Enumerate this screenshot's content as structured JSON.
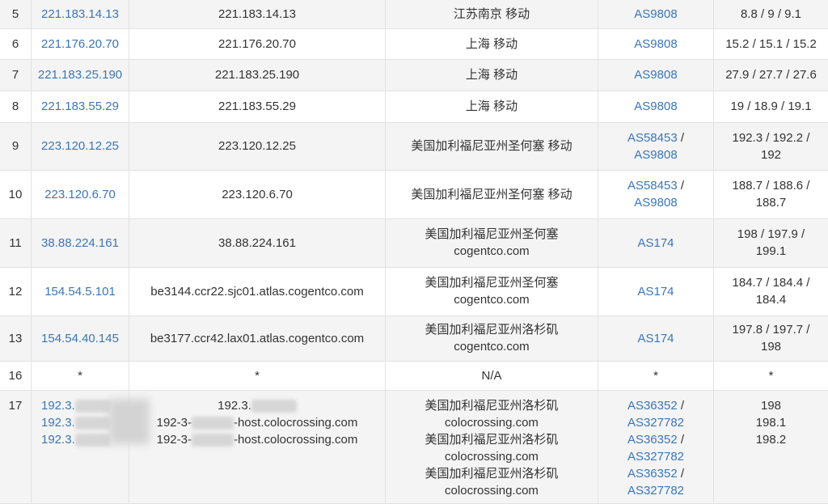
{
  "rows": [
    {
      "hop": "5",
      "ip": "221.183.14.13",
      "host": "221.183.14.13",
      "geo": "江苏南京 移动",
      "asn": "AS9808",
      "rtt": "8.8 / 9 / 9.1"
    },
    {
      "hop": "6",
      "ip": "221.176.20.70",
      "host": "221.176.20.70",
      "geo": "上海 移动",
      "asn": "AS9808",
      "rtt": "15.2 / 15.1 / 15.2"
    },
    {
      "hop": "7",
      "ip": "221.183.25.190",
      "host": "221.183.25.190",
      "geo": "上海 移动",
      "asn": "AS9808",
      "rtt": "27.9 / 27.7 / 27.6"
    },
    {
      "hop": "8",
      "ip": "221.183.55.29",
      "host": "221.183.55.29",
      "geo": "上海 移动",
      "asn": "AS9808",
      "rtt": "19 / 18.9 / 19.1"
    },
    {
      "hop": "9",
      "ip": "223.120.12.25",
      "host": "223.120.12.25",
      "geo": "美国加利福尼亚州圣何塞 移动",
      "asn1": "AS58453",
      "asn2": "AS9808",
      "rtt_a": "192.3 / 192.2 /",
      "rtt_b": "192"
    },
    {
      "hop": "10",
      "ip": "223.120.6.70",
      "host": "223.120.6.70",
      "geo": "美国加利福尼亚州圣何塞 移动",
      "asn1": "AS58453",
      "asn2": "AS9808",
      "rtt_a": "188.7 / 188.6 /",
      "rtt_b": "188.7"
    },
    {
      "hop": "11",
      "ip": "38.88.224.161",
      "host": "38.88.224.161",
      "geo_a": "美国加利福尼亚州圣何塞",
      "geo_b": "cogentco.com",
      "asn": "AS174",
      "rtt_a": "198 / 197.9 /",
      "rtt_b": "199.1"
    },
    {
      "hop": "12",
      "ip": "154.54.5.101",
      "host": "be3144.ccr22.sjc01.atlas.cogentco.com",
      "geo_a": "美国加利福尼亚州圣何塞",
      "geo_b": "cogentco.com",
      "asn": "AS174",
      "rtt_a": "184.7 / 184.4 /",
      "rtt_b": "184.4"
    },
    {
      "hop": "13",
      "ip": "154.54.40.145",
      "host": "be3177.ccr42.lax01.atlas.cogentco.com",
      "geo_a": "美国加利福尼亚州洛杉矶",
      "geo_b": "cogentco.com",
      "asn": "AS174",
      "rtt_a": "197.8 / 197.7 /",
      "rtt_b": "198"
    },
    {
      "hop": "16",
      "ip": "*",
      "host": "*",
      "geo": "N/A",
      "asn": "*",
      "rtt": "*"
    },
    {
      "hop": "17",
      "ip_lines": [
        "192.3.",
        "192.3.",
        "192.3."
      ],
      "host_a": "192.3.",
      "host_b_pre": "192-3-",
      "host_b_post": "-host.colocrossing.com",
      "host_c_pre": "192-3-",
      "host_c_post": "-host.colocrossing.com",
      "geo_lines": [
        "美国加利福尼亚州洛杉矶",
        "colocrossing.com",
        "美国加利福尼亚州洛杉矶",
        "colocrossing.com",
        "美国加利福尼亚州洛杉矶",
        "colocrossing.com"
      ],
      "asn_a": "AS36352",
      "asn_b": "AS327782",
      "rtt_lines": [
        "198",
        "198.1",
        "198.2"
      ],
      "sep": " /"
    }
  ],
  "colors": {
    "link": "#3a76b6",
    "text": "#333333",
    "stripe": "#f4f4f4",
    "border": "#e2e2e2"
  }
}
